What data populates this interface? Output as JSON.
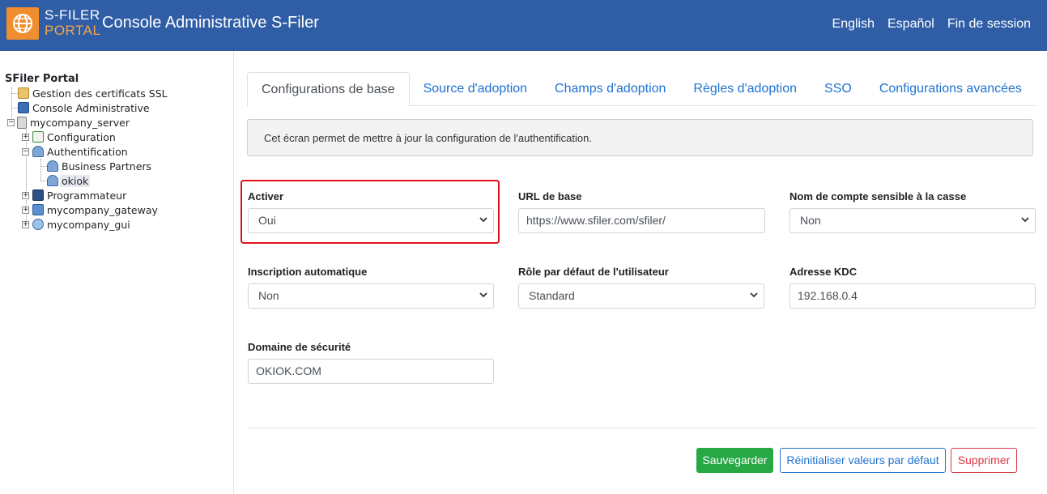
{
  "header": {
    "brand_line1": "S-FILER",
    "brand_line2": "PORTAL",
    "title": "Console Administrative S-Filer",
    "nav": [
      "English",
      "Español",
      "Fin de session"
    ]
  },
  "sidebar": {
    "root": "SFiler Portal",
    "nodes": [
      {
        "label": "Gestion des certificats SSL",
        "icon": "certificate-icon"
      },
      {
        "label": "Console Administrative",
        "icon": "gear-icon"
      },
      {
        "label": "mycompany_server",
        "icon": "server-icon"
      },
      {
        "label": "Configuration",
        "icon": "checklist-icon"
      },
      {
        "label": "Authentification",
        "icon": "users-icon"
      },
      {
        "label": "Business Partners",
        "icon": "users-icon"
      },
      {
        "label": "okiok",
        "icon": "users-icon"
      },
      {
        "label": "Programmateur",
        "icon": "clock-icon"
      },
      {
        "label": "mycompany_gateway",
        "icon": "network-icon"
      },
      {
        "label": "mycompany_gui",
        "icon": "globe-search-icon"
      }
    ]
  },
  "tabs": [
    "Configurations de base",
    "Source d'adoption",
    "Champs d'adoption",
    "Règles d'adoption",
    "SSO",
    "Configurations avancées"
  ],
  "info_text": "Cet écran permet de mettre à jour la configuration de l'authentification.",
  "form": {
    "activer": {
      "label": "Activer",
      "value": "Oui"
    },
    "url_base": {
      "label": "URL de base",
      "value": "https://www.sfiler.com/sfiler/"
    },
    "case_sensitive": {
      "label": "Nom de compte sensible à la casse",
      "value": "Non"
    },
    "auto_inscription": {
      "label": "Inscription automatique",
      "value": "Non"
    },
    "default_role": {
      "label": "Rôle par défaut de l'utilisateur",
      "value": "Standard"
    },
    "kdc": {
      "label": "Adresse KDC",
      "value": "192.168.0.4"
    },
    "domain": {
      "label": "Domaine de sécurité",
      "value": "OKIOK.COM"
    }
  },
  "buttons": {
    "save": "Sauvegarder",
    "reset": "Réinitialiser valeurs par défaut",
    "delete": "Supprimer"
  },
  "colors": {
    "header_bg": "#2f5ea6",
    "logo_bg": "#f08d2e",
    "link": "#1f72d1",
    "save": "#28a745",
    "delete": "#dc3545",
    "highlight": "#e0101a"
  }
}
